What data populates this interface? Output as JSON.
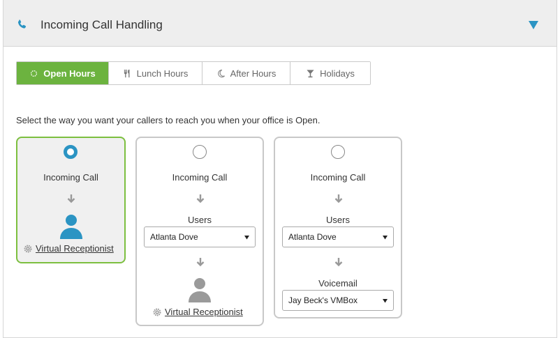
{
  "header": {
    "title": "Incoming Call Handling"
  },
  "tabs": [
    {
      "label": "Open Hours"
    },
    {
      "label": "Lunch Hours"
    },
    {
      "label": "After Hours"
    },
    {
      "label": "Holidays"
    }
  ],
  "prompt": "Select the way you want your callers to reach you when your office is Open.",
  "cards": [
    {
      "selected": true,
      "incoming_call": "Incoming Call",
      "link_text": "Virtual Receptionist"
    },
    {
      "selected": false,
      "incoming_call": "Incoming Call",
      "users_label": "Users",
      "users_value": "Atlanta Dove",
      "link_text": "Virtual Receptionist"
    },
    {
      "selected": false,
      "incoming_call": "Incoming Call",
      "users_label": "Users",
      "users_value": "Atlanta Dove",
      "voicemail_label": "Voicemail",
      "voicemail_value": "Jay Beck's VMBox"
    }
  ],
  "colors": {
    "accent_green": "#6cb33f",
    "accent_blue": "#2b94c3",
    "card_border_selected": "#7cbf3f"
  }
}
